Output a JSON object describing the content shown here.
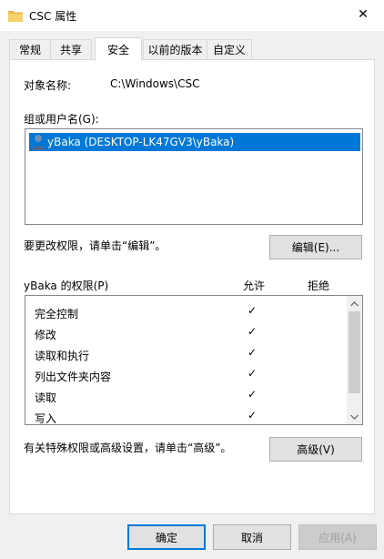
{
  "window": {
    "title": "CSC 属性",
    "close_symbol": "✕"
  },
  "tabs": [
    {
      "label": "常规"
    },
    {
      "label": "共享"
    },
    {
      "label": "安全",
      "active": true
    },
    {
      "label": "以前的版本"
    },
    {
      "label": "自定义"
    }
  ],
  "security": {
    "object_name_label": "对象名称:",
    "object_name_value": "C:\\Windows\\CSC",
    "group_users_label": "组或用户名(G):",
    "users": [
      {
        "name": "yBaka (DESKTOP-LK47GV3\\yBaka)",
        "selected": true
      }
    ],
    "change_permissions_hint": "要更改权限，请单击“编辑”。",
    "edit_button": "编辑(E)...",
    "permissions_for_label": "yBaka 的权限(P)",
    "allow_header": "允许",
    "deny_header": "拒绝",
    "permissions": [
      {
        "name": "完全控制",
        "allow": "✓",
        "deny": ""
      },
      {
        "name": "修改",
        "allow": "✓",
        "deny": ""
      },
      {
        "name": "读取和执行",
        "allow": "✓",
        "deny": ""
      },
      {
        "name": "列出文件夹内容",
        "allow": "✓",
        "deny": ""
      },
      {
        "name": "读取",
        "allow": "✓",
        "deny": ""
      },
      {
        "name": "写入",
        "allow": "✓",
        "deny": ""
      }
    ],
    "advanced_hint": "有关特殊权限或高级设置，请单击“高级”。",
    "advanced_button": "高级(V)"
  },
  "footer": {
    "ok_button": "确定",
    "cancel_button": "取消",
    "apply_button": "应用(A)"
  },
  "colors": {
    "selection": "#0078d7",
    "default_button_border": "#0078d7"
  }
}
